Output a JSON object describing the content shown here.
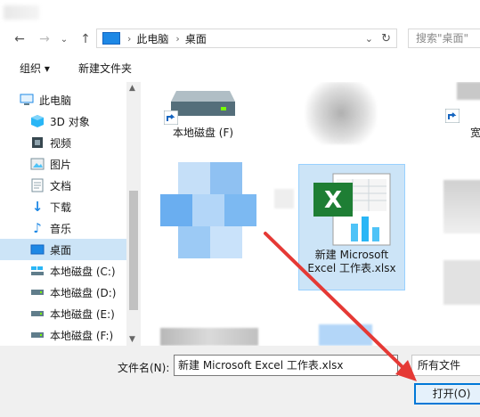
{
  "address": {
    "path": [
      "此电脑",
      "桌面"
    ],
    "search_placeholder": "搜索\"桌面\""
  },
  "toolbar": {
    "organize_label": "组织 ▾",
    "new_folder_label": "新建文件夹"
  },
  "nav": {
    "items": [
      {
        "label": "此电脑",
        "icon": "computer-icon"
      },
      {
        "label": "3D 对象",
        "icon": "3d-objects-icon"
      },
      {
        "label": "视频",
        "icon": "video-icon"
      },
      {
        "label": "图片",
        "icon": "pictures-icon"
      },
      {
        "label": "文档",
        "icon": "documents-icon"
      },
      {
        "label": "下载",
        "icon": "download-icon"
      },
      {
        "label": "音乐",
        "icon": "music-icon"
      },
      {
        "label": "桌面",
        "icon": "desktop-icon",
        "selected": true
      },
      {
        "label": "本地磁盘 (C:)",
        "icon": "drive-c-icon"
      },
      {
        "label": "本地磁盘 (D:)",
        "icon": "drive-icon"
      },
      {
        "label": "本地磁盘 (E:)",
        "icon": "drive-icon"
      },
      {
        "label": "本地磁盘 (F:)",
        "icon": "drive-icon"
      }
    ]
  },
  "content": {
    "drive_tile_label": "本地磁盘 (F)",
    "file_tile_line1": "新建 Microsoft",
    "file_tile_line2": "Excel 工作表.xlsx",
    "right_partial_label": "宽"
  },
  "footer": {
    "filename_label": "文件名(N):",
    "filename_value": "新建 Microsoft Excel 工作表.xlsx",
    "filter_value": "所有文件",
    "open_label": "打开(O)"
  },
  "colors": {
    "selection": "#cce4f7",
    "accent": "#0078d7",
    "annotation_arrow": "#e53935"
  }
}
